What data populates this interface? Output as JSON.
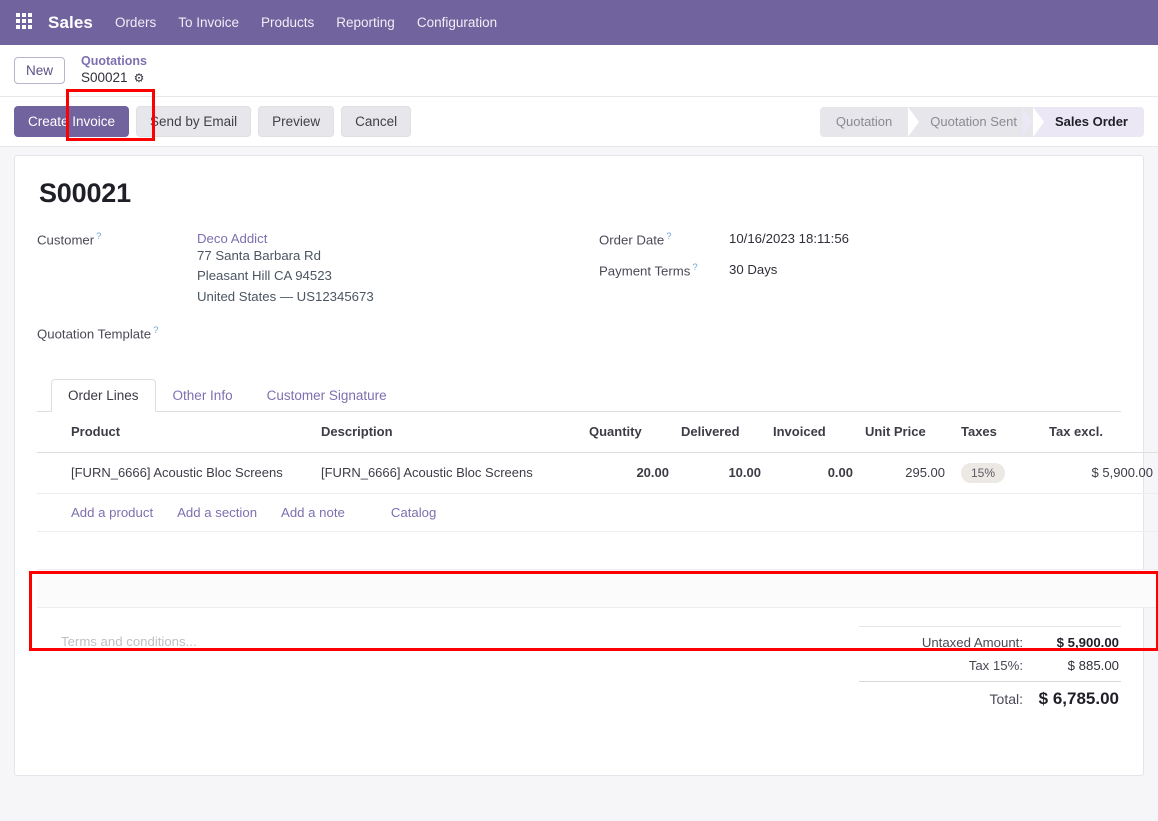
{
  "navbar": {
    "apps_icon": "apps-grid-icon",
    "brand": "Sales",
    "menu": [
      {
        "label": "Orders"
      },
      {
        "label": "To Invoice"
      },
      {
        "label": "Products"
      },
      {
        "label": "Reporting"
      },
      {
        "label": "Configuration"
      }
    ]
  },
  "control_panel": {
    "new_button": "New",
    "breadcrumb_parent": "Quotations",
    "breadcrumb_current": "S00021",
    "gear_icon": "gear-icon",
    "buttons": [
      {
        "label": "Create Invoice",
        "style": "primary"
      },
      {
        "label": "Send by Email",
        "style": "secondary"
      },
      {
        "label": "Preview",
        "style": "secondary"
      },
      {
        "label": "Cancel",
        "style": "secondary"
      }
    ],
    "statusbar": [
      {
        "label": "Quotation",
        "active": false
      },
      {
        "label": "Quotation Sent",
        "active": false
      },
      {
        "label": "Sales Order",
        "active": true
      }
    ]
  },
  "record": {
    "title": "S00021",
    "customer_label": "Customer",
    "customer_name": "Deco Addict",
    "customer_address": [
      "77 Santa Barbara Rd",
      "Pleasant Hill CA 94523",
      "United States — US12345673"
    ],
    "quotation_template_label": "Quotation Template",
    "quotation_template_value": "",
    "order_date_label": "Order Date",
    "order_date_value": "10/16/2023 18:11:56",
    "payment_terms_label": "Payment Terms",
    "payment_terms_value": "30 Days",
    "help_marker": "?"
  },
  "tabs": [
    {
      "label": "Order Lines",
      "active": true
    },
    {
      "label": "Other Info",
      "active": false
    },
    {
      "label": "Customer Signature",
      "active": false
    }
  ],
  "order_lines": {
    "columns": [
      "Product",
      "Description",
      "Quantity",
      "Delivered",
      "Invoiced",
      "Unit Price",
      "Taxes",
      "Tax excl."
    ],
    "options_icon": "sliders-icon",
    "rows": [
      {
        "product": "[FURN_6666] Acoustic Bloc Screens",
        "description": "[FURN_6666] Acoustic Bloc Screens",
        "quantity": "20.00",
        "delivered": "10.00",
        "invoiced": "0.00",
        "unit_price": "295.00",
        "taxes": "15%",
        "tax_excl": "$ 5,900.00",
        "delete_icon": "trash-icon"
      }
    ],
    "add_links": [
      {
        "label": "Add a product"
      },
      {
        "label": "Add a section"
      },
      {
        "label": "Add a note"
      },
      {
        "label": "Catalog"
      }
    ]
  },
  "notes": {
    "placeholder": "Terms and conditions..."
  },
  "totals": {
    "untaxed_label": "Untaxed Amount:",
    "untaxed_value": "$ 5,900.00",
    "tax_label": "Tax 15%:",
    "tax_value": "$ 885.00",
    "total_label": "Total:",
    "total_value": "$ 6,785.00"
  },
  "colors": {
    "brand_purple": "#71639e",
    "link_purple": "#7f6fb0",
    "annotation_red": "#ff0000",
    "number_blue": "#1a73c2",
    "page_bg": "#f6f6f9"
  }
}
